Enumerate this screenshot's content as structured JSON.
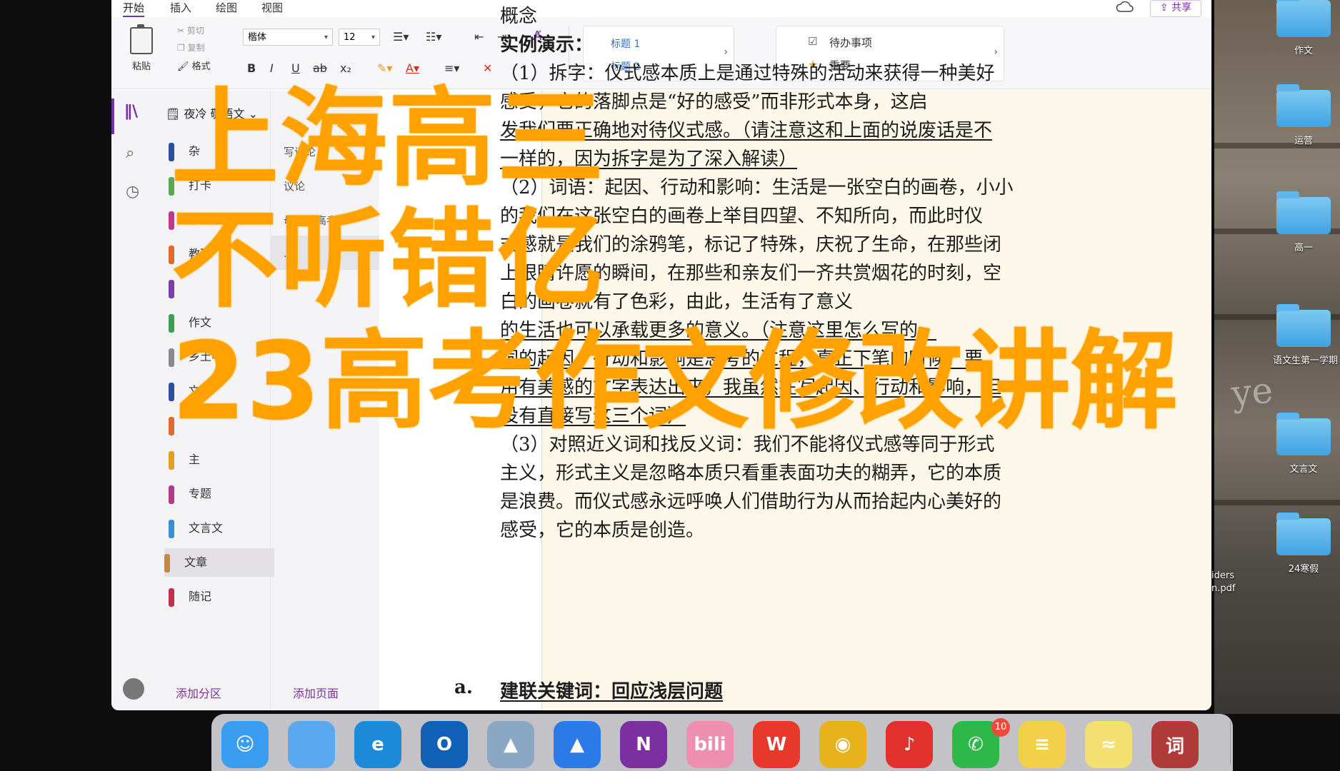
{
  "ribbon": {
    "tabs": [
      "开始",
      "插入",
      "绘图",
      "视图"
    ],
    "share_label": "共享",
    "paste_label": "粘贴",
    "cut_label": "剪切",
    "copy_label": "复制",
    "format_label": "格式",
    "font_name": "楷体",
    "font_size": "12",
    "bold": "B",
    "italic": "I",
    "underline": "U",
    "strike": "ab",
    "subscript": "x₂",
    "styles": [
      "标题 1",
      "标题 2"
    ],
    "tags": [
      "待办事项",
      "重要"
    ]
  },
  "sidebar": {
    "notebook": "夜冷 敬语文",
    "sections": [
      {
        "label": "杂",
        "color": "#2d4f9e"
      },
      {
        "label": "打卡",
        "color": "#5aa84f"
      },
      {
        "label": "小红书运营",
        "color": "#c03a8c"
      },
      {
        "label": "教研",
        "color": "#e36a2e"
      },
      {
        "label": "",
        "color": "#7b3fa8"
      },
      {
        "label": "作文",
        "color": "#3f9e55"
      },
      {
        "label": "乡土中国",
        "color": "#8a8a8a"
      },
      {
        "label": "文",
        "color": "#2d4f9e"
      },
      {
        "label": "",
        "color": "#e36a2e"
      },
      {
        "label": "主",
        "color": "#e0a020"
      },
      {
        "label": "专题",
        "color": "#b03a8c"
      },
      {
        "label": "文言文",
        "color": "#3a8fd0"
      },
      {
        "label": "文章",
        "color": "#c08a4e"
      },
      {
        "label": "随记",
        "color": "#c0304e"
      }
    ],
    "add_section": "添加分区",
    "add_page": "添加页面"
  },
  "pages": [
    "写议论",
    "议论",
    "母婴级高考...",
    "..."
  ],
  "note": {
    "lines": [
      {
        "text": "概念",
        "style": ""
      },
      {
        "text": "实例演示：",
        "style": "bold"
      },
      {
        "text": "（1）拆字：仪式感本质上是通过特殊的活动来获得一种美好",
        "style": ""
      },
      {
        "text": "感受，它的落脚点是“好的感受”而非形式本身，这启",
        "style": ""
      },
      {
        "text": "发我们要正确地对待仪式感。（请注意这和上面的说废话是不",
        "style": "ul"
      },
      {
        "text": "一样的，因为拆字是为了深入解读）",
        "style": "ul"
      },
      {
        "text": "（2）词语：起因、行动和影响：生活是一张空白的画卷，小小",
        "style": ""
      },
      {
        "text": "的我们在这张空白的画卷上举目四望、不知所向，而此时仪",
        "style": ""
      },
      {
        "text": "式感就是我们的涂鸦笔，标记了特殊，庆祝了生命，在那些闭",
        "style": ""
      },
      {
        "text": "上眼睛许愿的瞬间，在那些和亲友们一齐共赏烟花的时刻，空",
        "style": ""
      },
      {
        "text": "白的画卷就有了色彩，由此，生活有了意义",
        "style": ""
      },
      {
        "text": "的生活也可以承载更多的意义。（注意这里怎么写的，",
        "style": "ul"
      },
      {
        "text": "词的起因、行动和影响是思考的过程，真正下笔的时候，要",
        "style": "ul"
      },
      {
        "text": "用有美感的文字表达出来，我虽然在写起因、行动和影响，但",
        "style": "ul"
      },
      {
        "text": "没有直接写这三个词）",
        "style": "ul"
      },
      {
        "text": "（3）对照近义词和找反义词：我们不能将仪式感等同于形式",
        "style": ""
      },
      {
        "text": "主义，形式主义是忽略本质只看重表面功夫的糊弄，它的本质",
        "style": ""
      },
      {
        "text": "是浪费。而仪式感永远呼唤人们借助行为从而拾起内心美好的",
        "style": ""
      },
      {
        "text": "感受，它的本质是创造。",
        "style": ""
      }
    ],
    "heading_marker": "a.",
    "heading_text": "建联关键词：回应浅层问题"
  },
  "overlay": {
    "line1": "上海高三",
    "line2": "不听错亿",
    "line3": "23高考作文修改讲解"
  },
  "desktop": {
    "folders": [
      "作文",
      "运营",
      "高一",
      "语文生第一学期",
      "文言文",
      "24寒假"
    ],
    "file_label_1": "iders",
    "file_label_2": "n.pdf"
  },
  "dock": {
    "apps": [
      {
        "name": "finder",
        "glyph": "☺",
        "color": "#3a9df0"
      },
      {
        "name": "notes-app",
        "glyph": "",
        "color": "#5aa8f0"
      },
      {
        "name": "edge",
        "glyph": "e",
        "color": "#1c8ad8"
      },
      {
        "name": "outlook",
        "glyph": "O",
        "color": "#1160b8"
      },
      {
        "name": "photos",
        "glyph": "▲",
        "color": "#8aa7c4"
      },
      {
        "name": "lark",
        "glyph": "▲",
        "color": "#2c7ae8"
      },
      {
        "name": "onenote",
        "glyph": "N",
        "color": "#7b2fa0"
      },
      {
        "name": "bilibili",
        "glyph": "bili",
        "color": "#ef8fb0"
      },
      {
        "name": "wps",
        "glyph": "W",
        "color": "#e8382c"
      },
      {
        "name": "chrome",
        "glyph": "◉",
        "color": "#e8b21c"
      },
      {
        "name": "netease-music",
        "glyph": "♪",
        "color": "#e2312c"
      },
      {
        "name": "wechat",
        "glyph": "✆",
        "color": "#2fb84a"
      },
      {
        "name": "notes",
        "glyph": "≡",
        "color": "#f2d04a"
      },
      {
        "name": "stickies",
        "glyph": "≈",
        "color": "#f4e070"
      },
      {
        "name": "dictionary",
        "glyph": "词",
        "color": "#b03a3a"
      }
    ],
    "wechat_badge": "10"
  }
}
